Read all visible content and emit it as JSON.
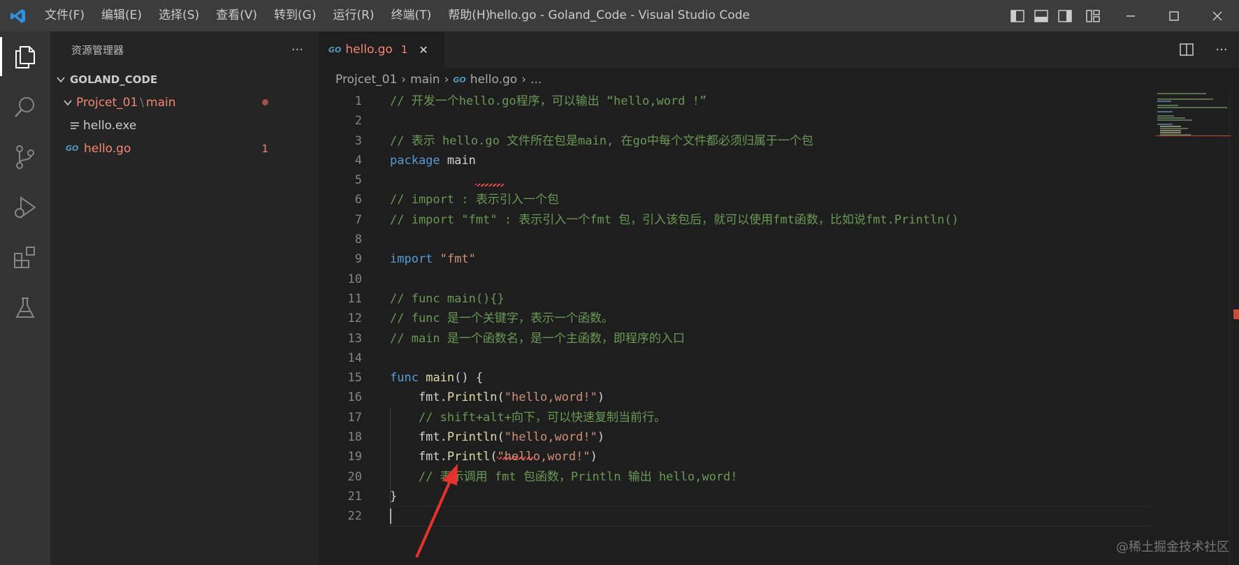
{
  "titlebar": {
    "menu": [
      "文件(F)",
      "编辑(E)",
      "选择(S)",
      "查看(V)",
      "转到(G)",
      "运行(R)",
      "终端(T)",
      "帮助(H)"
    ],
    "title": "hello.go - Goland_Code - Visual Studio Code"
  },
  "sidebar": {
    "title": "资源管理器",
    "more": "···",
    "root": "GOLAND_CODE",
    "folder": "Projcet_01",
    "folder_sep": "\\",
    "subfolder": "main",
    "files": [
      {
        "name": "hello.exe",
        "badge": ""
      },
      {
        "name": "hello.go",
        "badge": "1"
      }
    ]
  },
  "tab": {
    "icon_text": "GO",
    "label": "hello.go",
    "badge": "1",
    "close": "✕"
  },
  "breadcrumb": {
    "items": [
      "Projcet_01",
      "main",
      "hello.go",
      "..."
    ],
    "icon_text": "GO"
  },
  "editor_lines": [
    "// 开发一个hello.go程序，可以输出 “hello,word !”",
    "",
    "// 表示 hello.go 文件所在包是main, 在go中每个文件都必须归属于一个包",
    "package main",
    "",
    "// import : 表示引入一个包",
    "// import \"fmt\" : 表示引入一个fmt 包，引入该包后，就可以使用fmt函数，比如说fmt.Println()",
    "",
    "import \"fmt\"",
    "",
    "// func main(){}",
    "// func 是一个关键字，表示一个函数。",
    "// main 是一个函数名，是一个主函数，即程序的入口",
    "",
    "func main() {",
    "    fmt.Println(\"hello,word!\")",
    "    // shift+alt+向下，可以快速复制当前行。",
    "    fmt.Println(\"hello,word!\")",
    "    fmt.Printl(\"hello,word!\")",
    "    // 表示调用 fmt 包函数，Println 输出 hello,word!",
    "}",
    ""
  ],
  "watermark": "@稀土掘金技术社区",
  "colors": {
    "accent": "#f48771",
    "error": "#f14c4c",
    "annotation_arrow": "#e5322d"
  }
}
